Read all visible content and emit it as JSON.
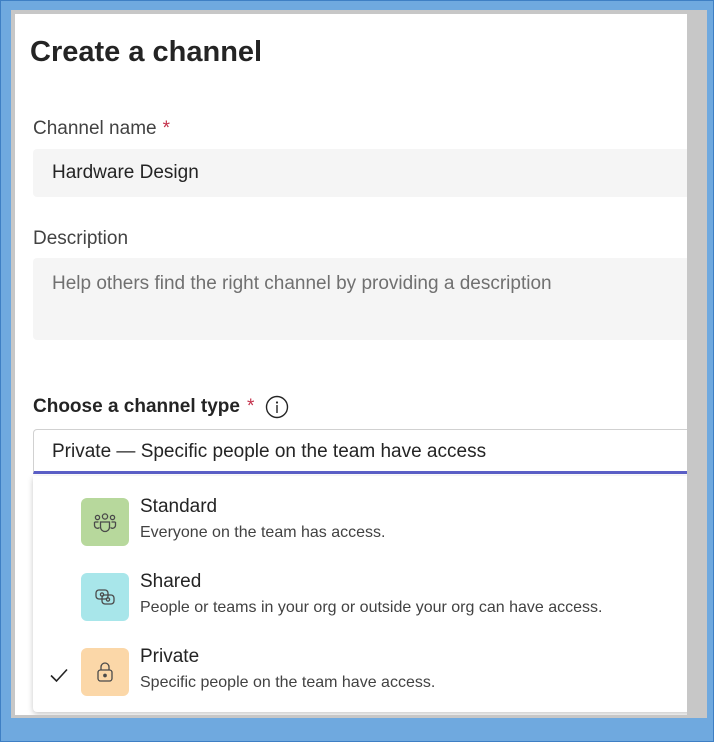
{
  "dialog": {
    "title": "Create a channel",
    "channel_name_label": "Channel name",
    "required_marker": "*",
    "channel_name_value": "Hardware Design",
    "description_label": "Description",
    "description_placeholder": "Help others find the right channel by providing a description",
    "channel_type_label": "Choose a channel type",
    "channel_type_selected": "Private — Specific people on the team have access",
    "channel_type_options": [
      {
        "title": "Standard",
        "description": "Everyone on the team has access.",
        "icon": "people-team-icon",
        "color": "#b7d89c",
        "selected": false
      },
      {
        "title": "Shared",
        "description": "People or teams in your org or outside your org can have access.",
        "icon": "shared-link-icon",
        "color": "#a8e6ea",
        "selected": false
      },
      {
        "title": "Private",
        "description": "Specific people on the team have access.",
        "icon": "lock-icon",
        "color": "#fbd7a8",
        "selected": true
      }
    ]
  },
  "colors": {
    "accent": "#5b5fc7",
    "required": "#c4314b",
    "frame": "#6fa9df"
  }
}
